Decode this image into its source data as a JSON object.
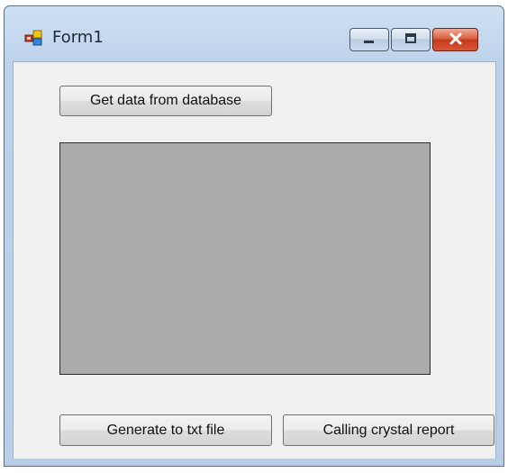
{
  "window": {
    "title": "Form1",
    "icon": "form-app-icon",
    "controls": {
      "minimize_icon": "minimize-icon",
      "maximize_icon": "maximize-icon",
      "close_icon": "close-icon"
    }
  },
  "form": {
    "get_data_button": "Get data from database",
    "generate_button": "Generate to txt file",
    "crystal_button": "Calling crystal report"
  },
  "colors": {
    "close_button": "#c43a1b",
    "grid_background": "#ababab",
    "form_background": "#f0f0f0"
  }
}
